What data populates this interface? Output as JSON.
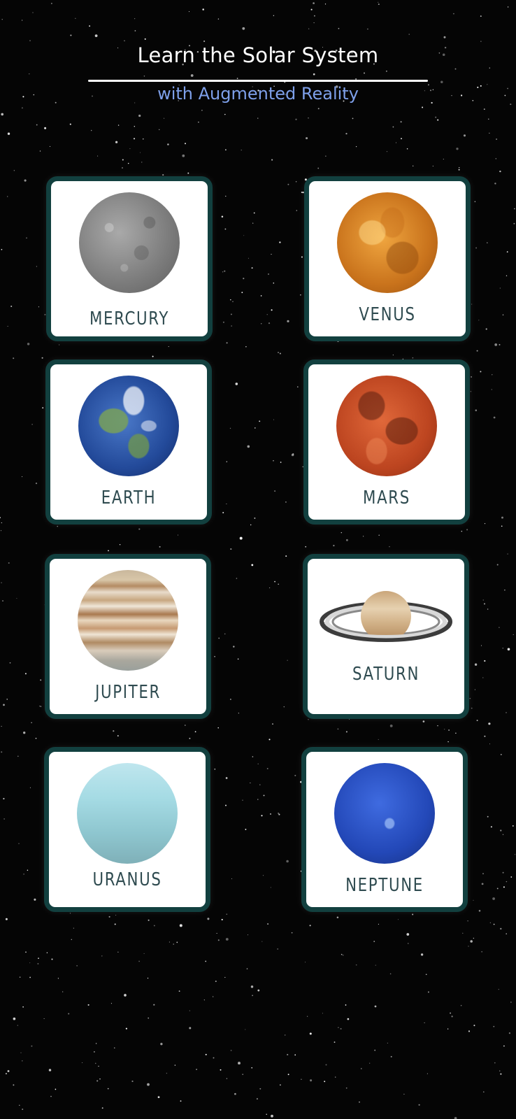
{
  "header": {
    "title": "Learn the Solar System",
    "subtitle": "with Augmented Reality"
  },
  "planets": [
    {
      "id": "mercury",
      "label": "MERCURY"
    },
    {
      "id": "venus",
      "label": "VENUS"
    },
    {
      "id": "earth",
      "label": "EARTH"
    },
    {
      "id": "mars",
      "label": "MARS"
    },
    {
      "id": "jupiter",
      "label": "JUPITER"
    },
    {
      "id": "saturn",
      "label": "SATURN"
    },
    {
      "id": "uranus",
      "label": "URANUS"
    },
    {
      "id": "neptune",
      "label": "NEPTUNE"
    }
  ],
  "colors": {
    "background": "#050505",
    "title": "#ffffff",
    "subtitle": "#7ea0ea",
    "card_border": "#12403f",
    "card_label": "#2f4b50"
  }
}
